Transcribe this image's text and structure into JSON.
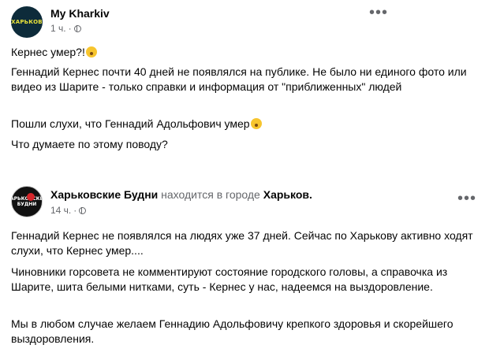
{
  "post1": {
    "author": "My Kharkiv",
    "avatar_text": "ХАРЬКОВ",
    "time": "1 ч.",
    "lines": [
      "Кернес умер?!",
      "Геннадий Кернес почти 40 дней не появлялся на публике. Не было ни единого фото или видео из Шарите - только справки и информация от \"приближенных\" людей",
      "Пошли слухи, что Геннадий Адольфович умер",
      "Что думаете по этому поводу?"
    ]
  },
  "post2": {
    "author": "Харьковские Будни",
    "location_prefix": "находится в городе",
    "location": "Харьков.",
    "avatar_text": "ХАРЬКОВСКИЕ БУДНИ",
    "time": "14 ч.",
    "lines": [
      "Геннадий Кернес не появлялся на людях уже 37 дней. Сейчас по Харькову активно ходят слухи, что Кернес умер....",
      "Чиновники горсовета не комментируют состояние городского головы, а справочка из Шарите, шита белыми нитками, суть - Кернес у нас, надеемся на выздоровление.",
      "Мы в любом случае желаем Геннадию Адольфовичу крепкого здоровья и скорейшего выздоровления."
    ]
  },
  "icons": {
    "privacy": "globe-icon",
    "more": "more-options-icon",
    "emoji_surprised": "astonished-emoji-icon"
  },
  "colors": {
    "muted": "#65676b",
    "text": "#050505"
  }
}
